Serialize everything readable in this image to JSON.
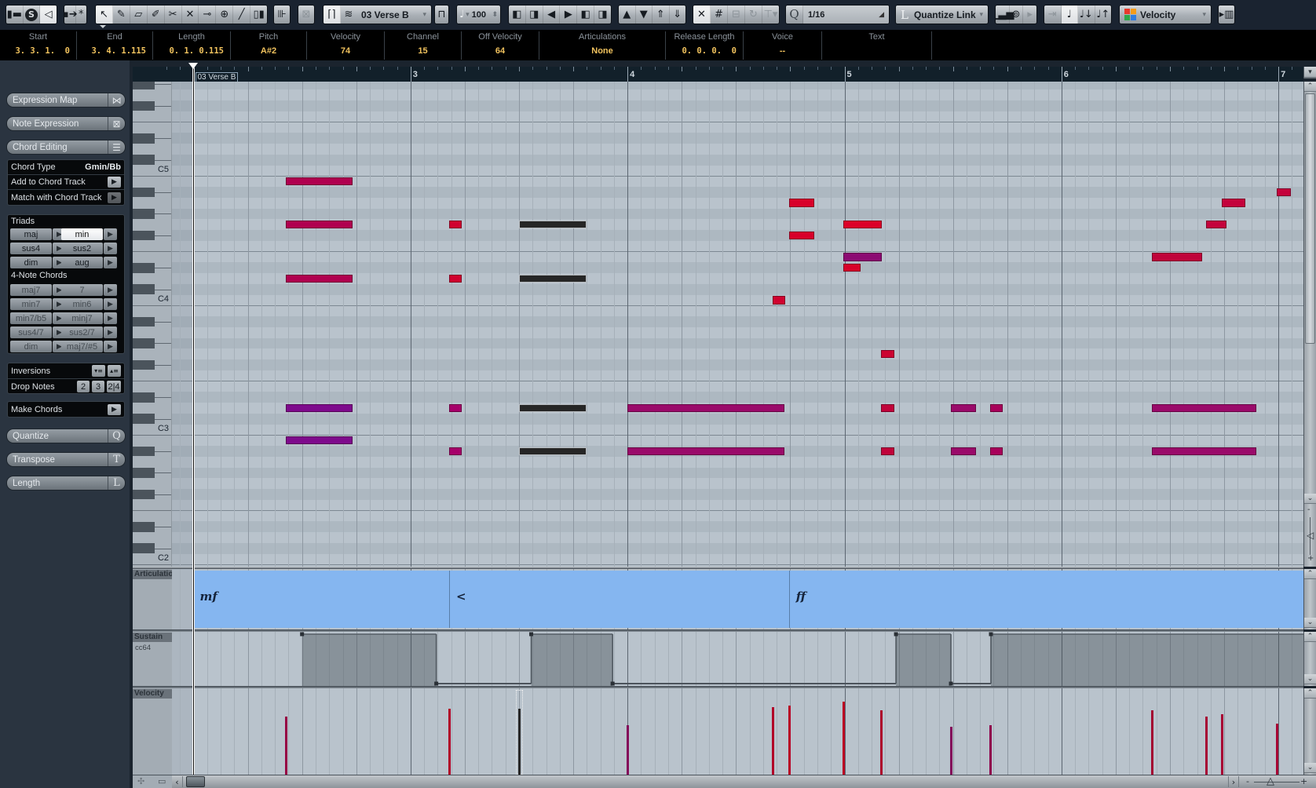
{
  "toolbar": {
    "view": [
      {
        "name": "show-inspector-button",
        "icon": "inspector-icon",
        "glyph": "▮▬"
      },
      {
        "name": "solo-editor-button",
        "icon": "solo-icon",
        "glyph": "S",
        "state": "circle"
      },
      {
        "name": "acoustic-feedback-button",
        "icon": "speaker-icon",
        "glyph": "◁",
        "state": "active"
      }
    ],
    "autoscroll": [
      {
        "name": "autoscroll-button",
        "icon": "autoscroll-icon",
        "glyph": "▪➔"
      },
      {
        "name": "suspend-autoscroll-button",
        "icon": "asterisk-icon",
        "glyph": "*"
      }
    ],
    "tools": [
      {
        "name": "object-selection-tool",
        "icon": "arrow-icon",
        "glyph": "↖",
        "state": "active"
      },
      {
        "name": "draw-tool",
        "icon": "pencil-icon",
        "glyph": "✎"
      },
      {
        "name": "erase-tool",
        "icon": "eraser-icon",
        "glyph": "▱"
      },
      {
        "name": "trim-tool",
        "icon": "knife-icon",
        "glyph": "✐"
      },
      {
        "name": "split-tool",
        "icon": "scissors-icon",
        "glyph": "✂"
      },
      {
        "name": "mute-tool",
        "icon": "x-icon",
        "glyph": "✕"
      },
      {
        "name": "glue-tool",
        "icon": "glue-tube-icon",
        "glyph": "⊸"
      },
      {
        "name": "zoom-tool",
        "icon": "magnifier-icon",
        "glyph": "⊕"
      },
      {
        "name": "line-tool",
        "icon": "line-icon",
        "glyph": "╱"
      },
      {
        "name": "time-warp-tool",
        "icon": "time-warp-icon",
        "glyph": "▯▮"
      }
    ],
    "lanes": [
      {
        "name": "auto-select-controllers-button",
        "icon": "controller-lanes-icon",
        "glyph": "⊪"
      }
    ],
    "info": [
      {
        "name": "show-info-button",
        "icon": "info-box-icon",
        "glyph": "⊠",
        "state": "disabled"
      }
    ],
    "part": {
      "borders_glyph": "⌈⌉",
      "layers_glyph": "≋",
      "value": "03 Verse B",
      "drop_glyph": "▾"
    },
    "loop": [
      {
        "name": "independent-loop-button",
        "icon": "loop-step-icon",
        "glyph": "⊓"
      }
    ],
    "insert_velocity": {
      "glyph": "♩",
      "drop_glyph": "▾",
      "value": "100",
      "spin_glyph": "⬍"
    },
    "nudge": [
      {
        "name": "trim-start-left-button",
        "icon": "trim-start-left-icon",
        "glyph": "◧"
      },
      {
        "name": "trim-start-right-button",
        "icon": "trim-start-right-icon",
        "glyph": "◨"
      },
      {
        "name": "move-left-button",
        "icon": "move-left-icon",
        "glyph": "◀"
      },
      {
        "name": "move-right-button",
        "icon": "move-right-icon",
        "glyph": "▶"
      },
      {
        "name": "trim-end-left-button",
        "icon": "trim-end-left-icon",
        "glyph": "◧"
      },
      {
        "name": "trim-end-right-button",
        "icon": "trim-end-right-icon",
        "glyph": "◨"
      }
    ],
    "transpose": [
      {
        "name": "transpose-up-button",
        "icon": "transpose-up-icon",
        "glyph": "▲"
      },
      {
        "name": "transpose-down-button",
        "icon": "transpose-down-icon",
        "glyph": "▼"
      },
      {
        "name": "transpose-octave-up-button",
        "icon": "transpose-octave-up-icon",
        "glyph": "⇑"
      },
      {
        "name": "transpose-octave-down-button",
        "icon": "transpose-octave-down-icon",
        "glyph": "⇓"
      }
    ],
    "snap": [
      {
        "name": "snap-button",
        "icon": "snap-icon",
        "glyph": "✕",
        "state": "active"
      },
      {
        "name": "grid-button",
        "icon": "grid-icon",
        "glyph": "#"
      },
      {
        "name": "snap-zero-button",
        "icon": "snap-zero-icon",
        "glyph": "⊟",
        "state": "disabled"
      },
      {
        "name": "cycle-snap-button",
        "icon": "cycle-icon",
        "glyph": "↻",
        "state": "disabled"
      },
      {
        "name": "grid-type-button",
        "icon": "grid-type-icon",
        "glyph": "⊤▾",
        "state": "disabled"
      }
    ],
    "quantize": {
      "glyph": "Q",
      "value": "1/16",
      "corner_glyph": "◢"
    },
    "length_quantize": {
      "glyph": "L",
      "value": "Quantize Link",
      "drop_glyph": "▾"
    },
    "step_input": [
      {
        "name": "step-input-button",
        "icon": "step-input-icon",
        "glyph": "▁▃▅"
      },
      {
        "name": "midi-input-button",
        "icon": "midi-connector-icon",
        "glyph": "⊚"
      },
      {
        "name": "input-options-button",
        "icon": "small-arrow-icon",
        "glyph": "▸",
        "state": "disabled"
      }
    ],
    "step_modes": [
      {
        "name": "move-insert-mode-button",
        "icon": "move-insert-icon",
        "glyph": "⇥",
        "state": "disabled"
      },
      {
        "name": "record-pitch-button",
        "icon": "note-icon",
        "glyph": "♩",
        "state": "active"
      },
      {
        "name": "record-note-on-button",
        "icon": "note-on-icon",
        "glyph": "♩↓"
      },
      {
        "name": "record-note-off-button",
        "icon": "note-off-icon",
        "glyph": "♩↑"
      }
    ],
    "color_scheme": {
      "value": "Velocity",
      "drop_glyph": "▾",
      "swatches": [
        "#e8392b",
        "#f59c1a",
        "#2ea84a",
        "#2f7de1"
      ]
    },
    "keyboard": [
      {
        "name": "virtual-keyboard-button",
        "icon": "piano-keys-icon",
        "glyph": "▸▥"
      }
    ]
  },
  "info_line": [
    {
      "label": "Start",
      "value": "3. 3. 1.  0"
    },
    {
      "label": "End",
      "value": "3. 4. 1.115"
    },
    {
      "label": "Length",
      "value": "0. 1. 0.115"
    },
    {
      "label": "Pitch",
      "value": "A#2"
    },
    {
      "label": "Velocity",
      "value": "74"
    },
    {
      "label": "Channel",
      "value": "15"
    },
    {
      "label": "Off Velocity",
      "value": "64"
    },
    {
      "label": "Articulations",
      "value": "None"
    },
    {
      "label": "Release Length",
      "value": "0. 0. 0.  0"
    },
    {
      "label": "Voice",
      "value": "--"
    },
    {
      "label": "Text",
      "value": ""
    }
  ],
  "inspector": {
    "sections": [
      {
        "label": "Expression Map",
        "glyph": "⋈"
      },
      {
        "label": "Note Expression",
        "glyph": "⊠"
      },
      {
        "label": "Chord Editing",
        "glyph": "☰"
      }
    ],
    "chord": {
      "type_label": "Chord Type",
      "type_value": "Gmin/Bb",
      "add_label": "Add to Chord Track",
      "match_label": "Match with Chord Track",
      "go_glyph": "▶"
    },
    "triads_label": "Triads",
    "triads": [
      [
        "maj",
        "min"
      ],
      [
        "sus4",
        "sus2"
      ],
      [
        "dim",
        "aug"
      ]
    ],
    "selected_triad": "min",
    "four_note_label": "4-Note Chords",
    "four_note": [
      [
        "maj7",
        "7"
      ],
      [
        "min7",
        "min6"
      ],
      [
        "min7/b5",
        "minj7"
      ],
      [
        "sus4/7",
        "sus2/7"
      ],
      [
        "dim",
        "maj7/#5"
      ]
    ],
    "arrow_glyph": "▶",
    "inversions_label": "Inversions",
    "inversion_glyphs": [
      "▾≡",
      "▴≡"
    ],
    "drop_notes_label": "Drop Notes",
    "drop_notes": [
      "2",
      "3",
      "2|4"
    ],
    "make_chords_label": "Make Chords",
    "functions": [
      {
        "label": "Quantize",
        "glyph": "Q"
      },
      {
        "label": "Transpose",
        "glyph": "T"
      },
      {
        "label": "Length",
        "glyph": "L"
      }
    ]
  },
  "editor": {
    "ruler": {
      "bars": [
        3,
        4,
        5,
        6,
        7
      ],
      "marker": "03 Verse B",
      "menu_glyph": "▾"
    },
    "keyboard_labels": [
      "C5",
      "C4",
      "C3",
      "C2"
    ],
    "notes": [
      {
        "start": 22.8,
        "length": 4.95,
        "pitch": "B4",
        "velocity": 85,
        "color": "#b0004f"
      },
      {
        "start": 22.8,
        "length": 4.95,
        "pitch": "G4",
        "velocity": 85,
        "color": "#b0004f"
      },
      {
        "start": 22.8,
        "length": 4.95,
        "pitch": "D4",
        "velocity": 85,
        "color": "#b0004f"
      },
      {
        "start": 22.8,
        "length": 4.95,
        "pitch": "D3",
        "velocity": 62,
        "color": "#7e0a8c"
      },
      {
        "start": 22.8,
        "length": 4.95,
        "pitch": "B2",
        "velocity": 62,
        "color": "#7e0a8c"
      },
      {
        "start": 34.84,
        "length": 0.93,
        "pitch": "G4",
        "velocity": 97,
        "color": "#d0022f"
      },
      {
        "start": 34.84,
        "length": 0.93,
        "pitch": "D4",
        "velocity": 97,
        "color": "#d0022f"
      },
      {
        "start": 34.84,
        "length": 0.93,
        "pitch": "D3",
        "velocity": 80,
        "color": "#a6006a"
      },
      {
        "start": 34.84,
        "length": 0.93,
        "pitch": "A#2",
        "velocity": 80,
        "color": "#a6006a"
      },
      {
        "start": 40,
        "length": 4.96,
        "pitch": "G4",
        "velocity": 97,
        "selected": true
      },
      {
        "start": 40,
        "length": 4.96,
        "pitch": "D4",
        "velocity": 97,
        "selected": true
      },
      {
        "start": 40,
        "length": 4.96,
        "pitch": "D3",
        "velocity": 97,
        "selected": true
      },
      {
        "start": 40,
        "length": 4.96,
        "pitch": "A#2",
        "velocity": 74,
        "selected": true
      },
      {
        "start": 48,
        "length": 11.6,
        "pitch": "D3",
        "velocity": 73,
        "color": "#9a0a6a"
      },
      {
        "start": 48,
        "length": 11.6,
        "pitch": "A#2",
        "velocity": 73,
        "color": "#9a0a6a"
      },
      {
        "start": 58.73,
        "length": 0.9,
        "pitch": "C4",
        "velocity": 99,
        "color": "#d0022f"
      },
      {
        "start": 59.91,
        "length": 1.86,
        "pitch": "A4",
        "velocity": 102,
        "color": "#d8002a"
      },
      {
        "start": 59.91,
        "length": 1.86,
        "pitch": "F#4",
        "velocity": 102,
        "color": "#d8002a"
      },
      {
        "start": 63.93,
        "length": 2.8,
        "pitch": "G4",
        "velocity": 107,
        "color": "#dc0028"
      },
      {
        "start": 63.93,
        "length": 2.8,
        "pitch": "E4",
        "velocity": 70,
        "color": "#8c0a72"
      },
      {
        "start": 63.93,
        "length": 1.24,
        "pitch": "D#4",
        "velocity": 104,
        "color": "#d8002a"
      },
      {
        "start": 66.72,
        "length": 0.99,
        "pitch": "G3",
        "velocity": 95,
        "color": "#cc0432"
      },
      {
        "start": 66.72,
        "length": 0.99,
        "pitch": "D3",
        "velocity": 92,
        "color": "#c0033a"
      },
      {
        "start": 66.72,
        "length": 0.99,
        "pitch": "A#2",
        "velocity": 92,
        "color": "#c0033a"
      },
      {
        "start": 71.85,
        "length": 1.86,
        "pitch": "D3",
        "velocity": 70,
        "color": "#9a0a6a"
      },
      {
        "start": 71.85,
        "length": 1.86,
        "pitch": "A#2",
        "velocity": 70,
        "color": "#9a0a6a"
      },
      {
        "start": 74.76,
        "length": 0.93,
        "pitch": "D3",
        "velocity": 73,
        "color": "#a8005a"
      },
      {
        "start": 74.76,
        "length": 0.93,
        "pitch": "A#2",
        "velocity": 73,
        "color": "#a8005a"
      },
      {
        "start": 86.65,
        "length": 3.71,
        "pitch": "E4",
        "velocity": 95,
        "color": "#c0033a"
      },
      {
        "start": 86.65,
        "length": 7.73,
        "pitch": "D3",
        "velocity": 75,
        "color": "#9a0a6a"
      },
      {
        "start": 86.65,
        "length": 7.73,
        "pitch": "A#2",
        "velocity": 75,
        "color": "#9a0a6a"
      },
      {
        "start": 90.67,
        "length": 1.48,
        "pitch": "G4",
        "velocity": 86,
        "color": "#c4023c"
      },
      {
        "start": 91.84,
        "length": 1.74,
        "pitch": "A4",
        "velocity": 89,
        "color": "#c4023c"
      },
      {
        "start": 95.87,
        "length": 1.05,
        "pitch": "A#4",
        "velocity": 75,
        "color": "#c4023c"
      }
    ],
    "lanes": {
      "articulation": {
        "label": "Articulations",
        "events": [
          {
            "pos": 16,
            "symbol": "mf"
          },
          {
            "pos": 34.85,
            "symbol": "<"
          },
          {
            "pos": 59.9,
            "symbol": "ff"
          }
        ]
      },
      "sustain": {
        "label": "Sustain",
        "controller": "cc64",
        "events": [
          {
            "pos": 24,
            "value": 127
          },
          {
            "pos": 33.9,
            "value": 0
          },
          {
            "pos": 40.9,
            "value": 127
          },
          {
            "pos": 46.9,
            "value": 0
          },
          {
            "pos": 67.8,
            "value": 127
          },
          {
            "pos": 71.85,
            "value": 0
          },
          {
            "pos": 74.8,
            "value": 127
          }
        ]
      },
      "velocity": {
        "label": "Velocity"
      }
    },
    "scroll_glyphs": {
      "up": "⌃",
      "down": "⌄",
      "left": "‹",
      "right": "›",
      "minus": "-",
      "plus": "+",
      "zoom_v": "◁",
      "zoom_h": "△"
    },
    "footer_glyphs": {
      "add_lane": "✣",
      "lane_presets": "▭"
    }
  }
}
